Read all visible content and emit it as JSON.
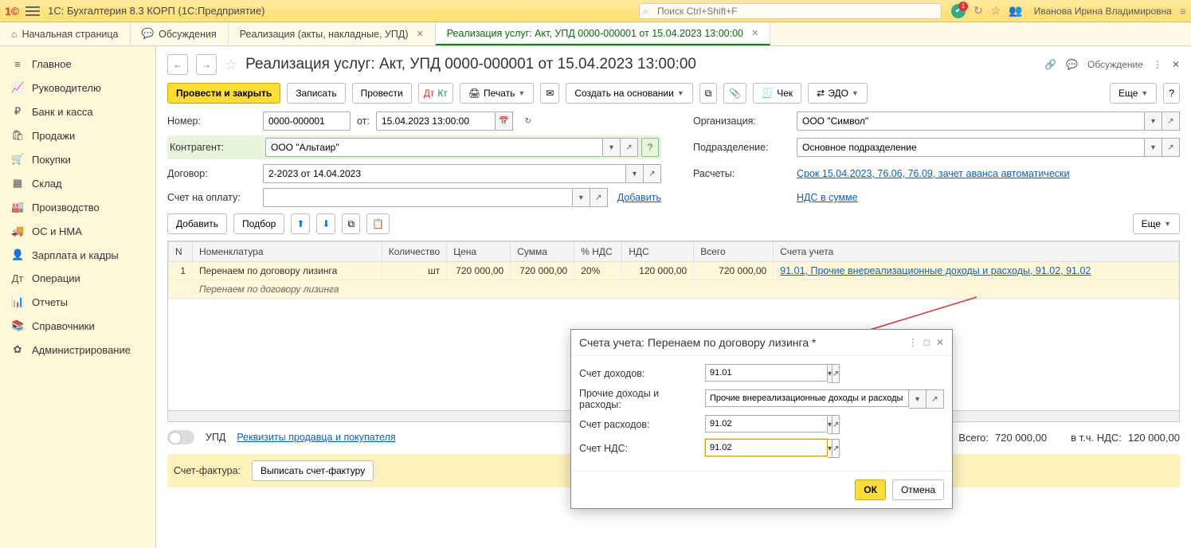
{
  "top": {
    "app_title": "1С: Бухгалтерия 8.3 КОРП  (1С:Предприятие)",
    "search_placeholder": "Поиск Ctrl+Shift+F",
    "user": "Иванова Ирина Владимировна",
    "badge": "1"
  },
  "tabs": [
    {
      "label": "Начальная страница",
      "icon": "home"
    },
    {
      "label": "Обсуждения",
      "icon": "chat"
    },
    {
      "label": "Реализация (акты, накладные, УПД)",
      "closable": true
    },
    {
      "label": "Реализация услуг: Акт, УПД 0000-000001 от 15.04.2023 13:00:00",
      "closable": true,
      "active": true
    }
  ],
  "sidebar": [
    {
      "icon": "≡",
      "label": "Главное"
    },
    {
      "icon": "📈",
      "label": "Руководителю"
    },
    {
      "icon": "₽",
      "label": "Банк и касса"
    },
    {
      "icon": "🛍",
      "label": "Продажи"
    },
    {
      "icon": "🛒",
      "label": "Покупки"
    },
    {
      "icon": "▦",
      "label": "Склад"
    },
    {
      "icon": "🏭",
      "label": "Производство"
    },
    {
      "icon": "🚚",
      "label": "ОС и НМА"
    },
    {
      "icon": "👤",
      "label": "Зарплата и кадры"
    },
    {
      "icon": "Дт",
      "label": "Операции"
    },
    {
      "icon": "📊",
      "label": "Отчеты"
    },
    {
      "icon": "📚",
      "label": "Справочники"
    },
    {
      "icon": "✿",
      "label": "Администрирование"
    }
  ],
  "doc": {
    "title": "Реализация услуг: Акт, УПД 0000-000001 от 15.04.2023 13:00:00",
    "discuss": "Обсуждение"
  },
  "toolbar": {
    "post_close": "Провести и закрыть",
    "save": "Записать",
    "post": "Провести",
    "print": "Печать",
    "create_based": "Создать на основании",
    "check": "Чек",
    "edo": "ЭДО",
    "more": "Еще"
  },
  "form": {
    "number_lbl": "Номер:",
    "number": "0000-000001",
    "from_lbl": "от:",
    "date": "15.04.2023 13:00:00",
    "org_lbl": "Организация:",
    "org": "ООО \"Символ\"",
    "contr_lbl": "Контрагент:",
    "contr": "ООО \"Альтаир\"",
    "division_lbl": "Подразделение:",
    "division": "Основное подразделение",
    "contract_lbl": "Договор:",
    "contract": "2-2023 от 14.04.2023",
    "calc_lbl": "Расчеты:",
    "calc_link": "Срок 15.04.2023, 76.06, 76.09, зачет аванса автоматически",
    "invoice_acc_lbl": "Счет на оплату:",
    "add_link": "Добавить",
    "nds_link": "НДС в сумме"
  },
  "subtb": {
    "add": "Добавить",
    "pick": "Подбор",
    "more": "Еще"
  },
  "table": {
    "headers": [
      "N",
      "Номенклатура",
      "Количество",
      "Цена",
      "Сумма",
      "% НДС",
      "НДС",
      "Всего",
      "Счета учета"
    ],
    "row": {
      "n": "1",
      "nomen": "Перенаем по договору лизинга",
      "nomen_sub": "Перенаем по договору лизинга",
      "qty_unit": "шт",
      "price": "720 000,00",
      "sum": "720 000,00",
      "nds_pct": "20%",
      "nds": "120 000,00",
      "total": "720 000,00",
      "accounts": "91.01, Прочие внереализационные доходы и расходы, 91.02, 91.02"
    }
  },
  "footer": {
    "upd": "УПД",
    "seller_link": "Реквизиты продавца и покупателя",
    "total_lbl": "Всего:",
    "total": "720 000,00",
    "nds_lbl": "в т.ч. НДС:",
    "nds": "120 000,00",
    "invoice_lbl": "Счет-фактура:",
    "invoice_btn": "Выписать счет-фактуру"
  },
  "popup": {
    "title": "Счета учета: Перенаем по договору лизинга *",
    "rows": [
      {
        "lbl": "Счет доходов:",
        "val": "91.01",
        "wide": false
      },
      {
        "lbl": "Прочие доходы и расходы:",
        "val": "Прочие внереализационные доходы и расходы",
        "wide": true
      },
      {
        "lbl": "Счет расходов:",
        "val": "91.02",
        "wide": false
      },
      {
        "lbl": "Счет НДС:",
        "val": "91.02",
        "wide": false,
        "highlight": true
      }
    ],
    "ok": "ОК",
    "cancel": "Отмена"
  }
}
